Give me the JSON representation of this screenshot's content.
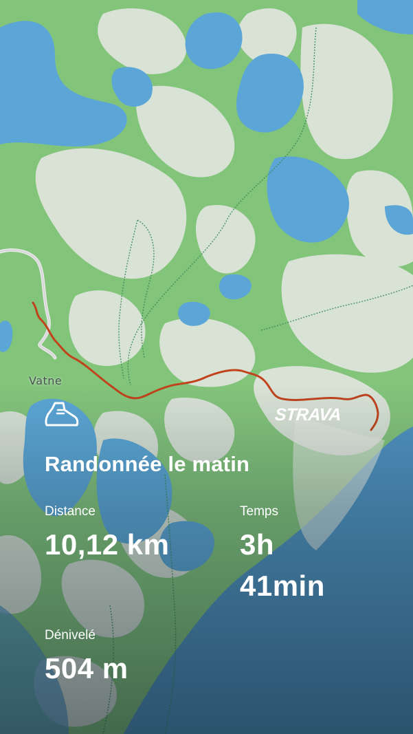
{
  "map": {
    "place_label": "Vatne",
    "colors": {
      "water": "#5aa6d6",
      "forest": "#82c47a",
      "open_land": "#d9e2d6",
      "route": "#c0431c",
      "road": "#e8e8e8"
    }
  },
  "activity": {
    "icon": "hiking-boot-icon",
    "brand": "STRAVA",
    "title": "Randonnée le matin",
    "stats": {
      "distance_label": "Distance",
      "distance_value": "10,12 km",
      "time_label": "Temps",
      "time_value_hours": "3h",
      "time_value_minutes": "41min",
      "elevation_label": "Dénivelé",
      "elevation_value": "504 m"
    }
  }
}
